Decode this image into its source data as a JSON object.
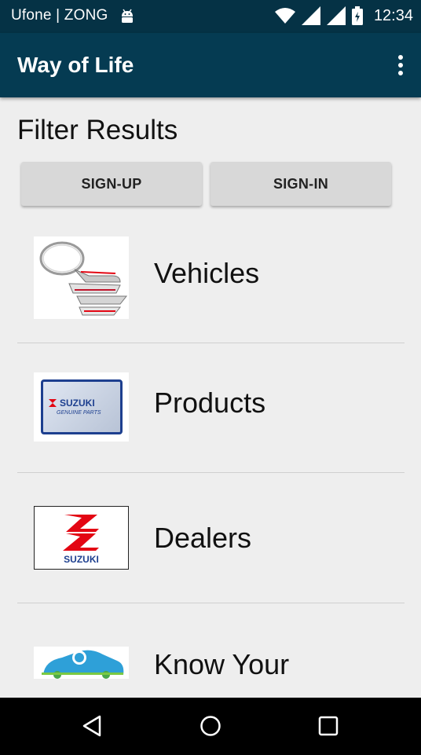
{
  "status_bar": {
    "carrier": "Ufone | ZONG",
    "time": "12:34"
  },
  "app_bar": {
    "title": "Way of Life",
    "overflow_icon": "more-vert-icon"
  },
  "main": {
    "heading": "Filter Results",
    "signup_label": "SIGN-UP",
    "signin_label": "SIGN-IN",
    "items": [
      {
        "label": "Vehicles",
        "icon": "suzuki-keychain-image"
      },
      {
        "label": "Products",
        "icon": "suzuki-genuine-parts-image"
      },
      {
        "label": "Dealers",
        "icon": "suzuki-logo-image"
      },
      {
        "label": "Know Your",
        "icon": "whats-my-car-worth-image"
      }
    ],
    "product_logo_text": "SUZUKI",
    "product_logo_sub": "GENUINE PARTS",
    "dealer_logo_text": "SUZUKI"
  },
  "nav_bar": {
    "back_icon": "back-triangle-icon",
    "home_icon": "home-circle-icon",
    "recents_icon": "recents-square-icon"
  },
  "colors": {
    "status_bar": "#053245",
    "app_bar": "#053b52",
    "background": "#eeeeee",
    "button": "#d8d8d8",
    "suzuki_red": "#e30613",
    "suzuki_blue": "#1d3f8f"
  }
}
